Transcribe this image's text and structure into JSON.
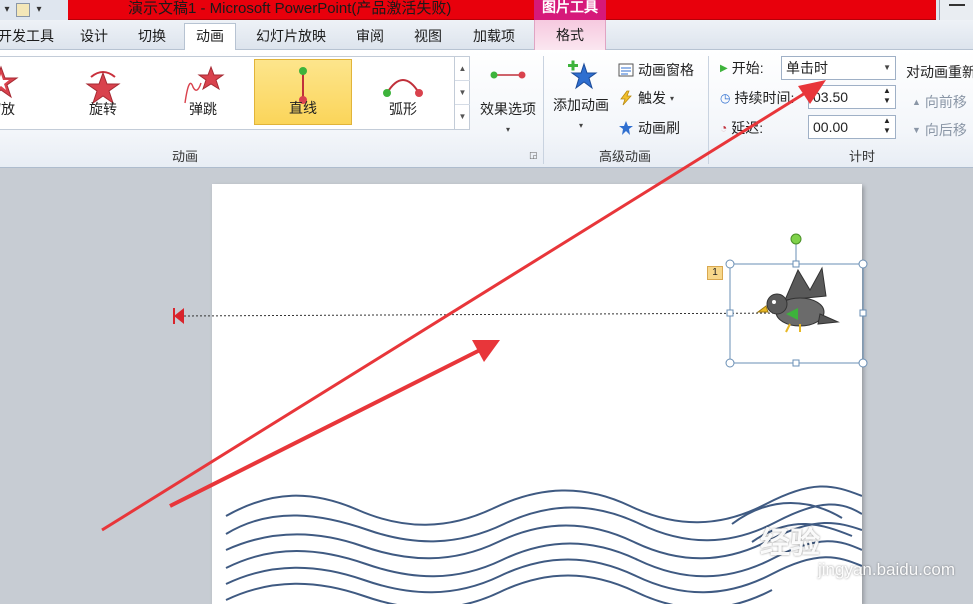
{
  "window": {
    "title": "演示文稿1 - Microsoft PowerPoint(产品激活失败)",
    "context_tab_group": "图片工具"
  },
  "tabs": [
    {
      "label": "开发工具"
    },
    {
      "label": "设计"
    },
    {
      "label": "切换"
    },
    {
      "label": "动画"
    },
    {
      "label": "幻灯片放映"
    },
    {
      "label": "审阅"
    },
    {
      "label": "视图"
    },
    {
      "label": "加载项"
    },
    {
      "label": "格式"
    }
  ],
  "ribbon": {
    "animation_group": {
      "label": "动画",
      "items": [
        {
          "label": "缩放",
          "icon": "zoom-star-icon"
        },
        {
          "label": "旋转",
          "icon": "spin-star-icon"
        },
        {
          "label": "弹跳",
          "icon": "bounce-star-icon"
        },
        {
          "label": "直线",
          "icon": "line-path-icon",
          "selected": true
        },
        {
          "label": "弧形",
          "icon": "arc-path-icon"
        }
      ],
      "effect_options_label": "效果选项"
    },
    "advanced_group": {
      "label": "高级动画",
      "add_animation_label": "添加动画",
      "pane_label": "动画窗格",
      "trigger_label": "触发",
      "painter_label": "动画刷"
    },
    "timing_group": {
      "label": "计时",
      "start_label": "开始:",
      "start_value": "单击时",
      "duration_label": "持续时间:",
      "duration_value": "03.50",
      "delay_label": "延迟:",
      "delay_value": "00.00",
      "reorder_label": "对动画重新",
      "move_earlier_label": "向前移",
      "move_later_label": "向后移"
    }
  },
  "slide": {
    "animation_number": "1"
  },
  "watermark": {
    "main": "经验",
    "sub": "jingyan.baidu.com"
  },
  "colors": {
    "title_red": "#e8000c",
    "context_pink": "#d6197a",
    "annotation_arrow": "#e8363a",
    "wave_blue": "#3f5a82"
  }
}
